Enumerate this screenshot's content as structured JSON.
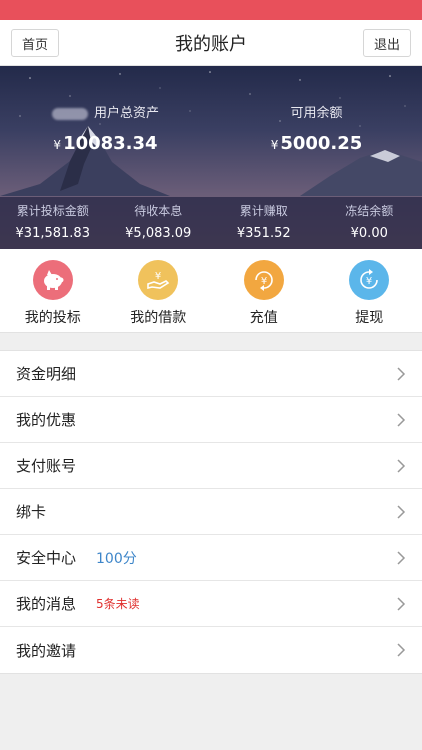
{
  "nav": {
    "title": "我的账户",
    "home_label": "首页",
    "logout_label": "退出"
  },
  "summary": {
    "total_assets_label": "用户总资产",
    "total_assets_currency": "¥",
    "total_assets_value": "10083.34",
    "available_balance_label": "可用余额",
    "available_balance_currency": "¥",
    "available_balance_value": "5000.25"
  },
  "stats": [
    {
      "label": "累计投标金额",
      "value": "¥31,581.83"
    },
    {
      "label": "待收本息",
      "value": "¥5,083.09"
    },
    {
      "label": "累计赚取",
      "value": "¥351.52"
    },
    {
      "label": "冻结余额",
      "value": "¥0.00"
    }
  ],
  "quick_actions": [
    {
      "label": "我的投标",
      "icon": "piggy-bank-icon",
      "color": "#ec6e7a"
    },
    {
      "label": "我的借款",
      "icon": "hand-yen-icon",
      "color": "#f0c25c"
    },
    {
      "label": "充值",
      "icon": "recharge-yen-icon",
      "color": "#f2a740"
    },
    {
      "label": "提现",
      "icon": "withdraw-yen-icon",
      "color": "#5bb6ea"
    }
  ],
  "menu": [
    {
      "label": "资金明细"
    },
    {
      "label": "我的优惠"
    },
    {
      "label": "支付账号"
    },
    {
      "label": "绑卡"
    },
    {
      "label": "安全中心",
      "extra": "100分"
    },
    {
      "label": "我的消息",
      "extra": "5条未读"
    },
    {
      "label": "我的邀请"
    }
  ],
  "colors": {
    "status_bar": "#e8505b",
    "score_blue": "#3e86c9",
    "unread_red": "#e0302e"
  }
}
